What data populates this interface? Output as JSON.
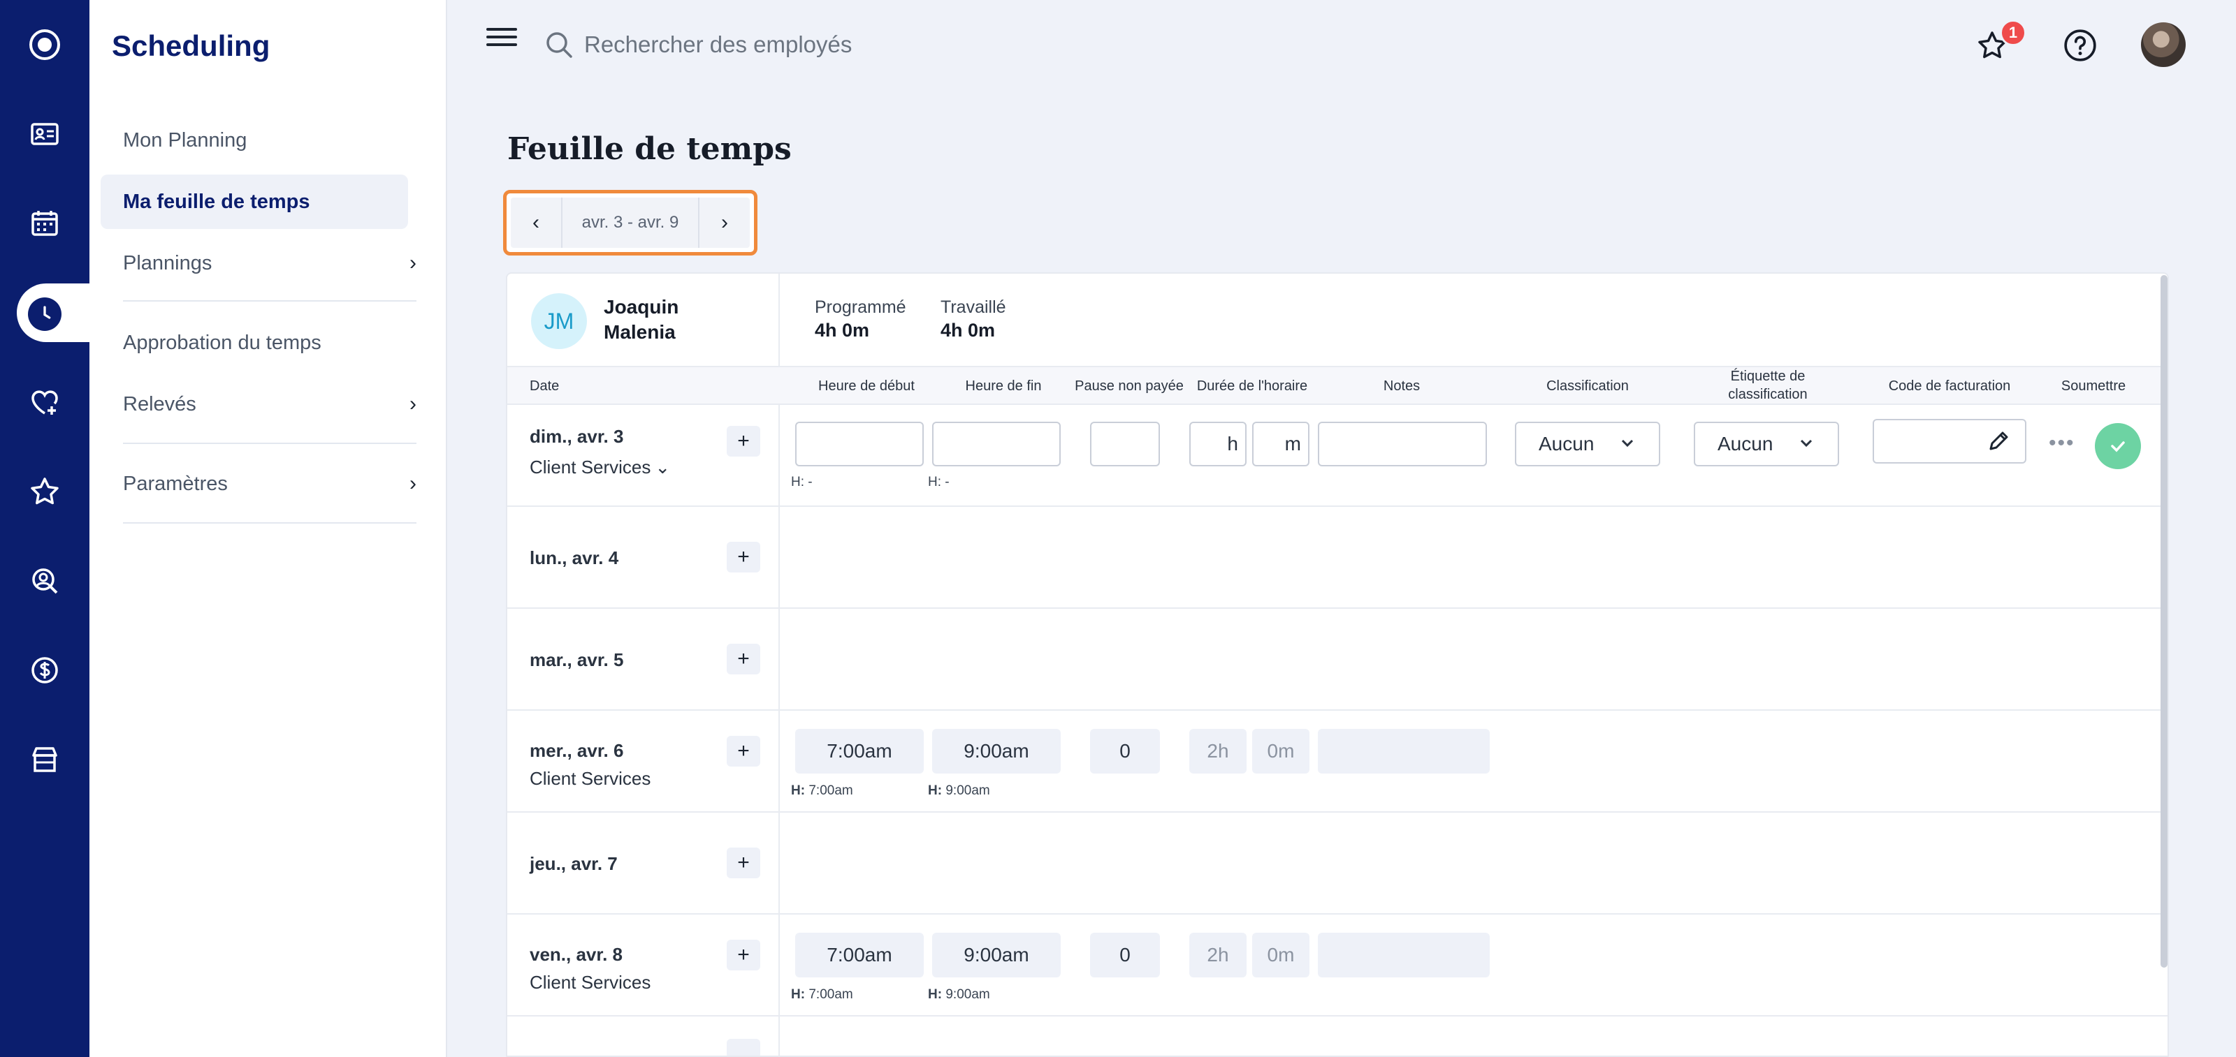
{
  "app": {
    "title": "Scheduling"
  },
  "nav": {
    "items": [
      {
        "label": "Mon Planning"
      },
      {
        "label": "Ma feuille de temps"
      },
      {
        "label": "Plannings"
      },
      {
        "label": "Approbation du temps"
      },
      {
        "label": "Relevés"
      },
      {
        "label": "Paramètres"
      }
    ]
  },
  "search": {
    "placeholder": "Rechercher des employés"
  },
  "header": {
    "notification_count": "1"
  },
  "page": {
    "title": "Feuille de temps"
  },
  "range": {
    "label": "avr. 3 - avr. 9"
  },
  "employee": {
    "initials": "JM",
    "first_name": "Joaquin",
    "last_name": "Malenia",
    "scheduled_label": "Programmé",
    "scheduled_value": "4h 0m",
    "worked_label": "Travaillé",
    "worked_value": "4h 0m"
  },
  "columns": {
    "date": "Date",
    "start": "Heure de début",
    "end": "Heure de fin",
    "break": "Pause non payée",
    "duration": "Durée de l'horaire",
    "notes": "Notes",
    "classification": "Classification",
    "tag_line1": "Étiquette de",
    "tag_line2": "classification",
    "billing": "Code de facturation",
    "submit": "Soumettre"
  },
  "rows": [
    {
      "day": "dim., avr. 3",
      "dept": "Client Services",
      "start_hint": "H: -",
      "end_hint": "H: -",
      "hours_unit": "h",
      "minutes_unit": "m",
      "classification": "Aucun",
      "tag": "Aucun"
    },
    {
      "day": "lun., avr. 4"
    },
    {
      "day": "mar., avr. 5"
    },
    {
      "day": "mer., avr. 6",
      "dept": "Client Services",
      "start": "7:00am",
      "end": "9:00am",
      "break": "0",
      "hours": "2h",
      "minutes": "0m",
      "start_hint_label": "H:",
      "start_hint": "7:00am",
      "end_hint_label": "H:",
      "end_hint": "9:00am"
    },
    {
      "day": "jeu., avr. 7"
    },
    {
      "day": "ven., avr. 8",
      "dept": "Client Services",
      "start": "7:00am",
      "end": "9:00am",
      "break": "0",
      "hours": "2h",
      "minutes": "0m",
      "start_hint_label": "H:",
      "start_hint": "7:00am",
      "end_hint_label": "H:",
      "end_hint": "9:00am"
    }
  ],
  "colors": {
    "rail": "#0b1e6e",
    "accent": "#f08a3c",
    "submit": "#6dd3a3",
    "badge": "#ef4b4b"
  }
}
